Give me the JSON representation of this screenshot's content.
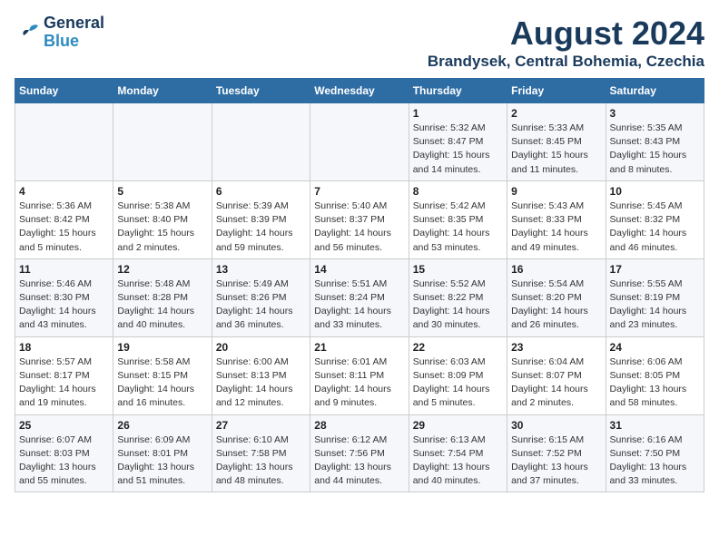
{
  "header": {
    "logo_line1": "General",
    "logo_line2": "Blue",
    "month": "August 2024",
    "location": "Brandysek, Central Bohemia, Czechia"
  },
  "weekdays": [
    "Sunday",
    "Monday",
    "Tuesday",
    "Wednesday",
    "Thursday",
    "Friday",
    "Saturday"
  ],
  "weeks": [
    [
      {
        "day": "",
        "info": ""
      },
      {
        "day": "",
        "info": ""
      },
      {
        "day": "",
        "info": ""
      },
      {
        "day": "",
        "info": ""
      },
      {
        "day": "1",
        "info": "Sunrise: 5:32 AM\nSunset: 8:47 PM\nDaylight: 15 hours\nand 14 minutes."
      },
      {
        "day": "2",
        "info": "Sunrise: 5:33 AM\nSunset: 8:45 PM\nDaylight: 15 hours\nand 11 minutes."
      },
      {
        "day": "3",
        "info": "Sunrise: 5:35 AM\nSunset: 8:43 PM\nDaylight: 15 hours\nand 8 minutes."
      }
    ],
    [
      {
        "day": "4",
        "info": "Sunrise: 5:36 AM\nSunset: 8:42 PM\nDaylight: 15 hours\nand 5 minutes."
      },
      {
        "day": "5",
        "info": "Sunrise: 5:38 AM\nSunset: 8:40 PM\nDaylight: 15 hours\nand 2 minutes."
      },
      {
        "day": "6",
        "info": "Sunrise: 5:39 AM\nSunset: 8:39 PM\nDaylight: 14 hours\nand 59 minutes."
      },
      {
        "day": "7",
        "info": "Sunrise: 5:40 AM\nSunset: 8:37 PM\nDaylight: 14 hours\nand 56 minutes."
      },
      {
        "day": "8",
        "info": "Sunrise: 5:42 AM\nSunset: 8:35 PM\nDaylight: 14 hours\nand 53 minutes."
      },
      {
        "day": "9",
        "info": "Sunrise: 5:43 AM\nSunset: 8:33 PM\nDaylight: 14 hours\nand 49 minutes."
      },
      {
        "day": "10",
        "info": "Sunrise: 5:45 AM\nSunset: 8:32 PM\nDaylight: 14 hours\nand 46 minutes."
      }
    ],
    [
      {
        "day": "11",
        "info": "Sunrise: 5:46 AM\nSunset: 8:30 PM\nDaylight: 14 hours\nand 43 minutes."
      },
      {
        "day": "12",
        "info": "Sunrise: 5:48 AM\nSunset: 8:28 PM\nDaylight: 14 hours\nand 40 minutes."
      },
      {
        "day": "13",
        "info": "Sunrise: 5:49 AM\nSunset: 8:26 PM\nDaylight: 14 hours\nand 36 minutes."
      },
      {
        "day": "14",
        "info": "Sunrise: 5:51 AM\nSunset: 8:24 PM\nDaylight: 14 hours\nand 33 minutes."
      },
      {
        "day": "15",
        "info": "Sunrise: 5:52 AM\nSunset: 8:22 PM\nDaylight: 14 hours\nand 30 minutes."
      },
      {
        "day": "16",
        "info": "Sunrise: 5:54 AM\nSunset: 8:20 PM\nDaylight: 14 hours\nand 26 minutes."
      },
      {
        "day": "17",
        "info": "Sunrise: 5:55 AM\nSunset: 8:19 PM\nDaylight: 14 hours\nand 23 minutes."
      }
    ],
    [
      {
        "day": "18",
        "info": "Sunrise: 5:57 AM\nSunset: 8:17 PM\nDaylight: 14 hours\nand 19 minutes."
      },
      {
        "day": "19",
        "info": "Sunrise: 5:58 AM\nSunset: 8:15 PM\nDaylight: 14 hours\nand 16 minutes."
      },
      {
        "day": "20",
        "info": "Sunrise: 6:00 AM\nSunset: 8:13 PM\nDaylight: 14 hours\nand 12 minutes."
      },
      {
        "day": "21",
        "info": "Sunrise: 6:01 AM\nSunset: 8:11 PM\nDaylight: 14 hours\nand 9 minutes."
      },
      {
        "day": "22",
        "info": "Sunrise: 6:03 AM\nSunset: 8:09 PM\nDaylight: 14 hours\nand 5 minutes."
      },
      {
        "day": "23",
        "info": "Sunrise: 6:04 AM\nSunset: 8:07 PM\nDaylight: 14 hours\nand 2 minutes."
      },
      {
        "day": "24",
        "info": "Sunrise: 6:06 AM\nSunset: 8:05 PM\nDaylight: 13 hours\nand 58 minutes."
      }
    ],
    [
      {
        "day": "25",
        "info": "Sunrise: 6:07 AM\nSunset: 8:03 PM\nDaylight: 13 hours\nand 55 minutes."
      },
      {
        "day": "26",
        "info": "Sunrise: 6:09 AM\nSunset: 8:01 PM\nDaylight: 13 hours\nand 51 minutes."
      },
      {
        "day": "27",
        "info": "Sunrise: 6:10 AM\nSunset: 7:58 PM\nDaylight: 13 hours\nand 48 minutes."
      },
      {
        "day": "28",
        "info": "Sunrise: 6:12 AM\nSunset: 7:56 PM\nDaylight: 13 hours\nand 44 minutes."
      },
      {
        "day": "29",
        "info": "Sunrise: 6:13 AM\nSunset: 7:54 PM\nDaylight: 13 hours\nand 40 minutes."
      },
      {
        "day": "30",
        "info": "Sunrise: 6:15 AM\nSunset: 7:52 PM\nDaylight: 13 hours\nand 37 minutes."
      },
      {
        "day": "31",
        "info": "Sunrise: 6:16 AM\nSunset: 7:50 PM\nDaylight: 13 hours\nand 33 minutes."
      }
    ]
  ]
}
